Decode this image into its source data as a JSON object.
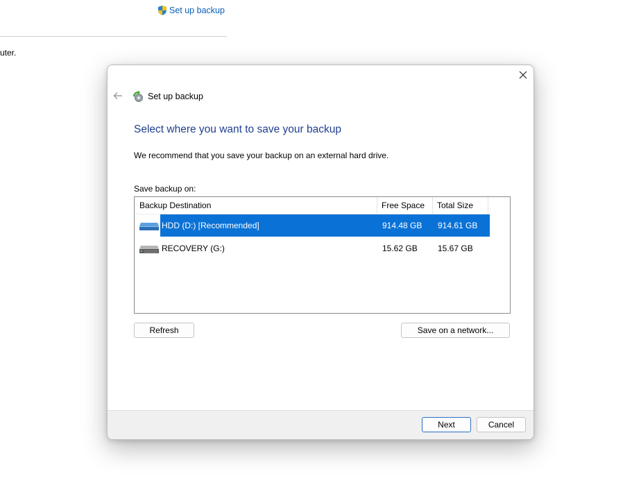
{
  "background": {
    "link_label": "Set up backup",
    "partial_text": "uter."
  },
  "dialog": {
    "header_title": "Set up backup",
    "main_title": "Select where you want to save your backup",
    "recommend_text": "We recommend that you save your backup on an external hard drive.",
    "save_label": "Save backup on:",
    "columns": {
      "destination": "Backup Destination",
      "free": "Free Space",
      "total": "Total Size"
    },
    "rows": [
      {
        "name": "HDD (D:) [Recommended]",
        "free": "914.48 GB",
        "total": "914.61 GB",
        "selected": true,
        "icon": "blue-drive-icon"
      },
      {
        "name": "RECOVERY (G:)",
        "free": "15.62 GB",
        "total": "15.67 GB",
        "selected": false,
        "icon": "gray-drive-icon"
      }
    ],
    "buttons": {
      "refresh": "Refresh",
      "network": "Save on a network...",
      "next": "Next",
      "cancel": "Cancel"
    }
  },
  "colors": {
    "selection": "#0a72d6",
    "title": "#1f3f8f",
    "link": "#0a5fb8"
  }
}
